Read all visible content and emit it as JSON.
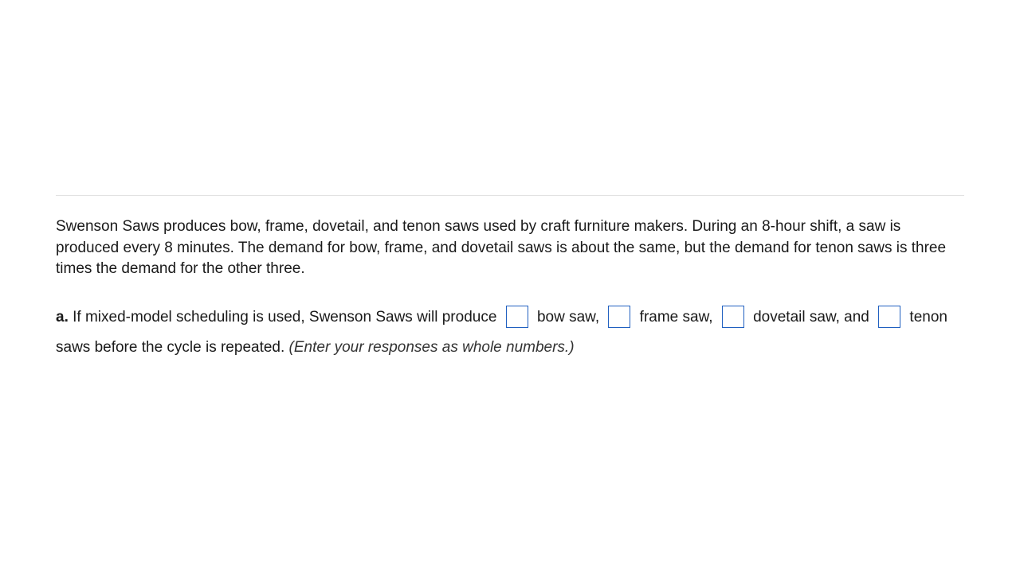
{
  "problem": {
    "statement": "Swenson Saws produces bow, frame, dovetail, and tenon saws used by craft furniture makers. During an 8-hour shift, a saw is produced every 8 minutes. The demand for bow, frame, and dovetail saws is about the same, but the demand for tenon saws is three times the demand for the other three."
  },
  "question": {
    "part_label": "a.",
    "segment1": " If mixed-model scheduling is used, Swenson Saws will produce ",
    "label1": " bow saw, ",
    "label2": " frame saw, ",
    "label3": " dovetail saw, and ",
    "label4": " tenon saws before the cycle is repeated. ",
    "hint": "(Enter your responses as whole numbers.)"
  }
}
